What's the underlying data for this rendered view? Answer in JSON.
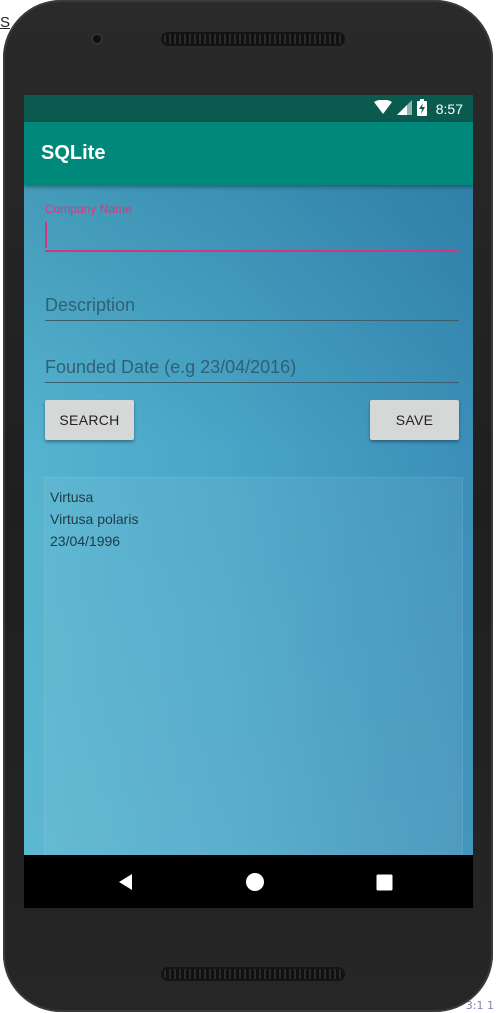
{
  "page_fragments": {
    "corner_left": "S",
    "corner_bottom_right": "3:1 1"
  },
  "status_bar": {
    "time": "8:57",
    "icons": [
      "wifi-icon",
      "signal-icon",
      "battery-charging-icon"
    ]
  },
  "app_bar": {
    "title": "SQLite"
  },
  "form": {
    "company_name": {
      "label": "Company Name",
      "value": "",
      "placeholder": "",
      "focused": true
    },
    "description": {
      "placeholder": "Description",
      "value": ""
    },
    "founded_date": {
      "placeholder": "Founded Date (e.g 23/04/2016)",
      "value": ""
    }
  },
  "buttons": {
    "search_label": "SEARCH",
    "save_label": "SAVE"
  },
  "result": {
    "lines": [
      "Virtusa",
      "Virtusa polaris",
      "23/04/1996"
    ]
  },
  "nav_bar": {
    "icons": [
      "back-icon",
      "home-icon",
      "recents-icon"
    ]
  },
  "colors": {
    "status_bar": "#0a5a4f",
    "app_bar": "#00897b",
    "accent": "#d63384",
    "content_gradient_start": "#55b4cf",
    "content_gradient_end": "#3a8fb8",
    "button_bg": "#d6d7d7"
  }
}
